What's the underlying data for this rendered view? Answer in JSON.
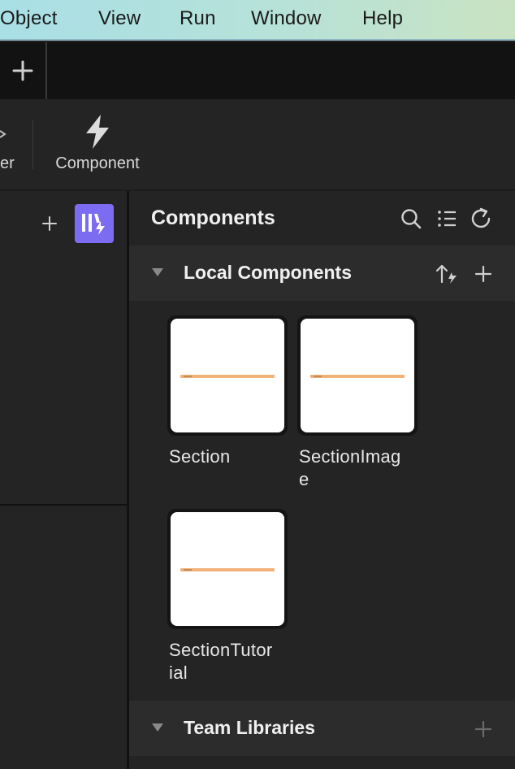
{
  "menu": [
    "Object",
    "View",
    "Run",
    "Window",
    "Help"
  ],
  "toolbar": {
    "partial_label": "er",
    "component_label": "Component"
  },
  "components_panel": {
    "title": "Components",
    "icons": [
      "search-icon",
      "list-icon",
      "refresh-icon"
    ],
    "local_section": {
      "title": "Local Components",
      "icons": [
        "sort-icon",
        "add-icon"
      ],
      "items": [
        {
          "label_line1": "Section",
          "label_line2": ""
        },
        {
          "label_line1": "SectionImag",
          "label_line2": "e"
        },
        {
          "label_line1": "SectionTutor",
          "label_line2": "ial"
        }
      ]
    },
    "team_section": {
      "title": "Team Libraries",
      "icons": [
        "add-icon"
      ]
    }
  },
  "colors": {
    "menubar_start": "#a9dfe6",
    "menubar_end": "#c9e3c2",
    "plugin_accent": "#7b6cf2",
    "component_bar": "#f1b27a",
    "panel_bg": "#242424"
  }
}
